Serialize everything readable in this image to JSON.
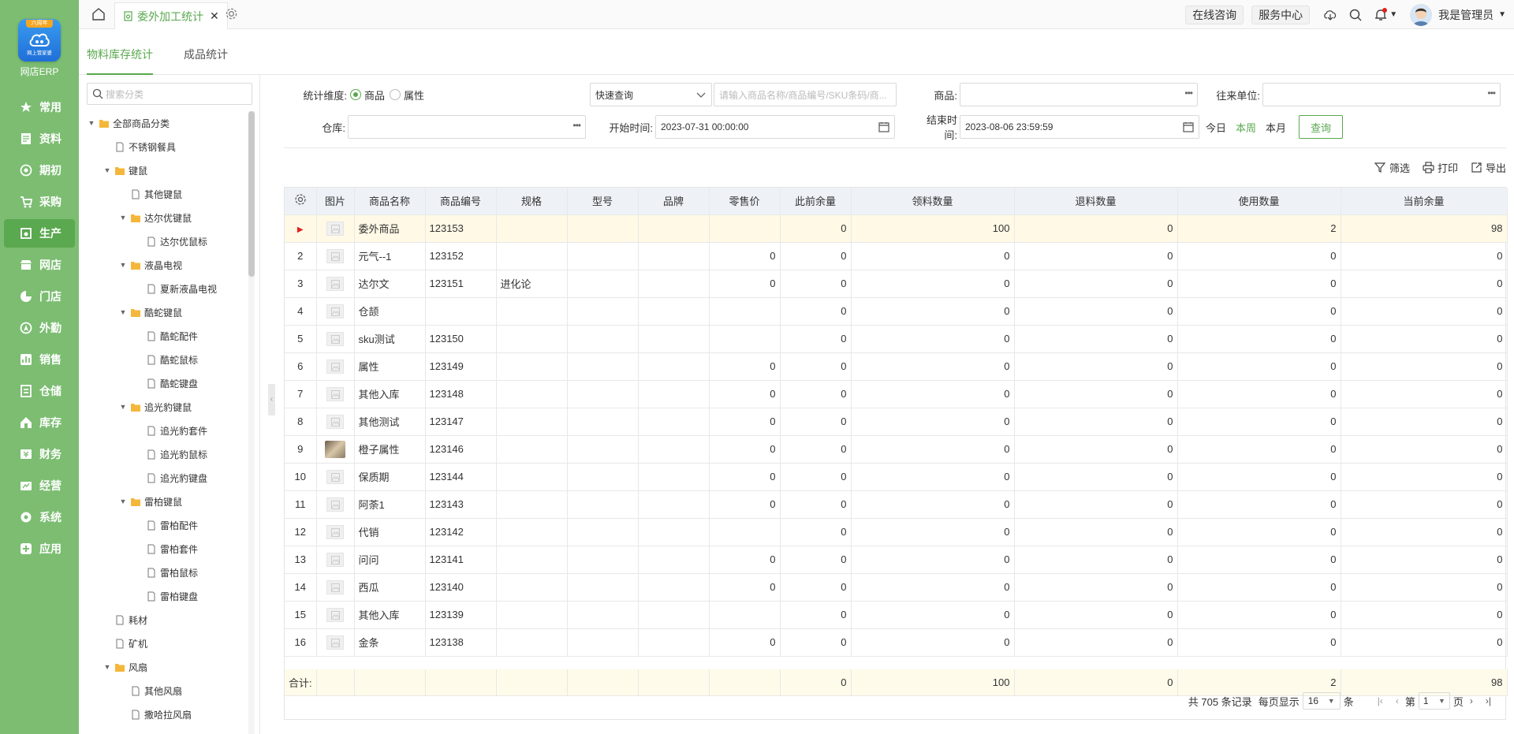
{
  "app": {
    "logo_tag": "六周年",
    "logo_sub": "网上管家婆",
    "name": "网店ERP"
  },
  "nav": [
    {
      "label": "常用",
      "icon": "star-icon"
    },
    {
      "label": "资料",
      "icon": "document-icon"
    },
    {
      "label": "期初",
      "icon": "target-icon"
    },
    {
      "label": "采购",
      "icon": "cart-icon"
    },
    {
      "label": "生产",
      "icon": "factory-icon",
      "active": true
    },
    {
      "label": "网店",
      "icon": "shop-icon"
    },
    {
      "label": "门店",
      "icon": "pie-icon"
    },
    {
      "label": "外勤",
      "icon": "location-icon"
    },
    {
      "label": "销售",
      "icon": "chart-icon"
    },
    {
      "label": "仓储",
      "icon": "warehouse-icon"
    },
    {
      "label": "库存",
      "icon": "home-stock-icon"
    },
    {
      "label": "财务",
      "icon": "finance-icon"
    },
    {
      "label": "经营",
      "icon": "business-icon"
    },
    {
      "label": "系统",
      "icon": "gear-icon"
    },
    {
      "label": "应用",
      "icon": "plus-icon"
    }
  ],
  "topbar": {
    "tab_title": "委外加工统计",
    "online": "在线咨询",
    "service": "服务中心",
    "user": "我是管理员"
  },
  "subtabs": [
    "物料库存统计",
    "成品统计"
  ],
  "tree": {
    "search_placeholder": "搜索分类",
    "nodes": [
      {
        "label": "全部商品分类",
        "level": 0,
        "folder": true,
        "open": true
      },
      {
        "label": "不锈钢餐具",
        "level": 1,
        "folder": false
      },
      {
        "label": "键鼠",
        "level": 1,
        "folder": true,
        "open": true
      },
      {
        "label": "其他键鼠",
        "level": 2,
        "folder": false
      },
      {
        "label": "达尔优键鼠",
        "level": 2,
        "folder": true,
        "open": true
      },
      {
        "label": "达尔优鼠标",
        "level": 3,
        "folder": false
      },
      {
        "label": "液晶电视",
        "level": 2,
        "folder": true,
        "open": true
      },
      {
        "label": "夏新液晶电视",
        "level": 3,
        "folder": false
      },
      {
        "label": "酷蛇键鼠",
        "level": 2,
        "folder": true,
        "open": true
      },
      {
        "label": "酷蛇配件",
        "level": 3,
        "folder": false
      },
      {
        "label": "酷蛇鼠标",
        "level": 3,
        "folder": false
      },
      {
        "label": "酷蛇键盘",
        "level": 3,
        "folder": false
      },
      {
        "label": "追光豹键鼠",
        "level": 2,
        "folder": true,
        "open": true
      },
      {
        "label": "追光豹套件",
        "level": 3,
        "folder": false
      },
      {
        "label": "追光豹鼠标",
        "level": 3,
        "folder": false
      },
      {
        "label": "追光豹键盘",
        "level": 3,
        "folder": false
      },
      {
        "label": "雷柏键鼠",
        "level": 2,
        "folder": true,
        "open": true
      },
      {
        "label": "雷柏配件",
        "level": 3,
        "folder": false
      },
      {
        "label": "雷柏套件",
        "level": 3,
        "folder": false
      },
      {
        "label": "雷柏鼠标",
        "level": 3,
        "folder": false
      },
      {
        "label": "雷柏键盘",
        "level": 3,
        "folder": false
      },
      {
        "label": "耗材",
        "level": 1,
        "folder": false
      },
      {
        "label": "矿机",
        "level": 1,
        "folder": false
      },
      {
        "label": "风扇",
        "level": 1,
        "folder": true,
        "open": true
      },
      {
        "label": "其他风扇",
        "level": 2,
        "folder": false
      },
      {
        "label": "撒哈拉风扇",
        "level": 2,
        "folder": false
      }
    ]
  },
  "filters": {
    "dim_label": "统计维度:",
    "dim_goods": "商品",
    "dim_attr": "属性",
    "quick_select": "快速查询",
    "quick_placeholder": "请输入商品名称/商品编号/SKU条码/商...",
    "goods_label": "商品:",
    "partner_label": "往来单位:",
    "warehouse_label": "仓库:",
    "start_label": "开始时间:",
    "start_value": "2023-07-31 00:00:00",
    "end_label": "结束时间:",
    "end_value": "2023-08-06 23:59:59",
    "today": "今日",
    "this_week": "本周",
    "this_month": "本月",
    "query": "查询"
  },
  "actions": {
    "filter": "筛选",
    "print": "打印",
    "export": "导出"
  },
  "table": {
    "headers": [
      "图片",
      "商品名称",
      "商品编号",
      "规格",
      "型号",
      "品牌",
      "零售价",
      "此前余量",
      "领料数量",
      "退料数量",
      "使用数量",
      "当前余量"
    ],
    "rows": [
      {
        "no": "",
        "name": "委外商品",
        "code": "123153",
        "spec": "",
        "price": "",
        "prev": "0",
        "pick": "100",
        "ret": "0",
        "use": "2",
        "cur": "98",
        "img": false,
        "sel": true
      },
      {
        "no": "2",
        "name": "元气--1",
        "code": "123152",
        "spec": "",
        "price": "0",
        "prev": "0",
        "pick": "0",
        "ret": "0",
        "use": "0",
        "cur": "0",
        "img": false
      },
      {
        "no": "3",
        "name": "达尔文",
        "code": "123151",
        "spec": "进化论",
        "price": "0",
        "prev": "0",
        "pick": "0",
        "ret": "0",
        "use": "0",
        "cur": "0",
        "img": false
      },
      {
        "no": "4",
        "name": "仓颉",
        "code": "",
        "spec": "",
        "price": "",
        "prev": "0",
        "pick": "0",
        "ret": "0",
        "use": "0",
        "cur": "0",
        "img": false
      },
      {
        "no": "5",
        "name": "sku测试",
        "code": "123150",
        "spec": "",
        "price": "",
        "prev": "0",
        "pick": "0",
        "ret": "0",
        "use": "0",
        "cur": "0",
        "img": false
      },
      {
        "no": "6",
        "name": "属性",
        "code": "123149",
        "spec": "",
        "price": "0",
        "prev": "0",
        "pick": "0",
        "ret": "0",
        "use": "0",
        "cur": "0",
        "img": false
      },
      {
        "no": "7",
        "name": "其他入库",
        "code": "123148",
        "spec": "",
        "price": "0",
        "prev": "0",
        "pick": "0",
        "ret": "0",
        "use": "0",
        "cur": "0",
        "img": false
      },
      {
        "no": "8",
        "name": "其他测试",
        "code": "123147",
        "spec": "",
        "price": "0",
        "prev": "0",
        "pick": "0",
        "ret": "0",
        "use": "0",
        "cur": "0",
        "img": false
      },
      {
        "no": "9",
        "name": "橙子属性",
        "code": "123146",
        "spec": "",
        "price": "0",
        "prev": "0",
        "pick": "0",
        "ret": "0",
        "use": "0",
        "cur": "0",
        "img": true
      },
      {
        "no": "10",
        "name": "保质期",
        "code": "123144",
        "spec": "",
        "price": "0",
        "prev": "0",
        "pick": "0",
        "ret": "0",
        "use": "0",
        "cur": "0",
        "img": false
      },
      {
        "no": "11",
        "name": "阿荼1",
        "code": "123143",
        "spec": "",
        "price": "0",
        "prev": "0",
        "pick": "0",
        "ret": "0",
        "use": "0",
        "cur": "0",
        "img": false
      },
      {
        "no": "12",
        "name": "代销",
        "code": "123142",
        "spec": "",
        "price": "",
        "prev": "0",
        "pick": "0",
        "ret": "0",
        "use": "0",
        "cur": "0",
        "img": false
      },
      {
        "no": "13",
        "name": "问问",
        "code": "123141",
        "spec": "",
        "price": "0",
        "prev": "0",
        "pick": "0",
        "ret": "0",
        "use": "0",
        "cur": "0",
        "img": false
      },
      {
        "no": "14",
        "name": "西瓜",
        "code": "123140",
        "spec": "",
        "price": "0",
        "prev": "0",
        "pick": "0",
        "ret": "0",
        "use": "0",
        "cur": "0",
        "img": false
      },
      {
        "no": "15",
        "name": "其他入库",
        "code": "123139",
        "spec": "",
        "price": "",
        "prev": "0",
        "pick": "0",
        "ret": "0",
        "use": "0",
        "cur": "0",
        "img": false
      },
      {
        "no": "16",
        "name": "金条",
        "code": "123138",
        "spec": "",
        "price": "0",
        "prev": "0",
        "pick": "0",
        "ret": "0",
        "use": "0",
        "cur": "0",
        "img": false
      }
    ],
    "summary": {
      "label": "合计:",
      "prev": "0",
      "pick": "100",
      "ret": "0",
      "use": "2",
      "cur": "98"
    }
  },
  "pager": {
    "total": "共 705 条记录",
    "per_page_label": "每页显示",
    "per_page": "16",
    "unit": "条",
    "page_prefix": "第",
    "page": "1",
    "page_suffix": "页"
  },
  "colors": {
    "accent": "#5aa84f",
    "sidebar": "#7cbd72",
    "selected_row": "#fff9e6",
    "summary_row": "#fefbea",
    "header_bg": "#eef2f7"
  }
}
